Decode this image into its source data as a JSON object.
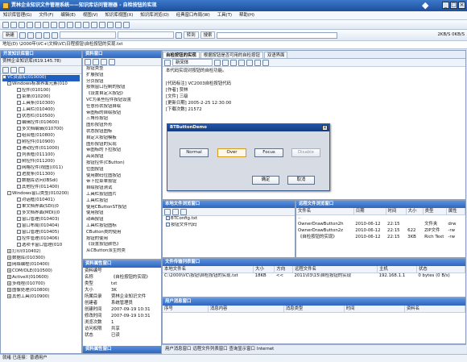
{
  "app": {
    "title": "贾林企业知识文件管理系统——知识库访问管理器 - 自检按钮的实现",
    "status": "就绪 已连接：普通用户"
  },
  "menu": [
    "知识库管理(G)",
    "文件(F)",
    "编辑(E)",
    "视图(V)",
    "知识库视图(X)",
    "知识库浏览(O)",
    "经典窗口布局(W)",
    "工具(T)",
    "帮助(H)"
  ],
  "toolbar": {
    "new_label": "新建",
    "folder_label": "转到",
    "search_label": "搜索",
    "search_placeholder": "",
    "version": "2KB/S 0KB/S"
  },
  "address": "地址(D) \\2000年\\VC+\\文档\\VC\\日程按钮\\自检按钮的实现.txt",
  "left_panel": {
    "title": "开发知识库窗口",
    "subtitle": "贾林企业知识库(619.145.78)",
    "tree": [
      "VC资源库(010000)",
      "Windows标准界面元素(010",
      "控件(010100)",
      "菜单(010200)",
      "工具条(010300)",
      "工具栏(010400)",
      "状态栏(010500)",
      "编辑控件(010600)",
      "多文档编辑(010700)",
      "组合框(010800)",
      "树控件(010900)",
      "滑动控件(011000)",
      "列表框(011100)",
      "树控件(011200)",
      "网格控件(视图)(011)",
      "进度条(011300)",
      "数据库访问(IBSdi)",
      "其他控件(011400)",
      "Windows窗口类型(010200)",
      "对话框(010401)",
      "单文档界面(SDI)(0",
      "多文档界面(MDI)(0",
      "窗口管理(010403)",
      "窗口布局(010404)",
      "窗口管理(010405)",
      "控件管理(010406)",
      "选项卡窗口管理(010",
      "打印(010402)",
      "数据库(010300)",
      "网络编程(010400)",
      "COM/OLE(010500)",
      "ActiveX(010600)",
      "多线程(010700)",
      "图像处理(010800)",
      "其他工具(010900)"
    ]
  },
  "resource_panel": {
    "title": "资料窗口",
    "items": [
      "按钮类型",
      "扩展按钮",
      "分页按钮",
      "按照窗口控制的按钮",
      "《设置自定义按钮》",
      "VC为某些控件按钮设置",
      "任意形状按钮自绘",
      "带图标的自绘按钮",
      "三角形按钮",
      "图形按钮外形",
      "状态按钮图标",
      "自定义按钮模板",
      "图形按钮的实现",
      "带图标的下拉按钮",
      "高亮按钮",
      "按钮控件(CButton)",
      "位图按钮",
      "使用数码位图按钮",
      "带下拉菜单按钮",
      "自绘按钮测试",
      "工具栏按钮图片",
      "工具栏按钮",
      "使用CButtonST按钮",
      "使用按钮",
      "动画按钮",
      "工具栏按钮图标",
      "CButton类的使用",
      "按钮的使用",
      "《设置按钮颜色》",
      "从CButton派生的类",
      "在VC中实现按钮图标",
      "在对话框中使用按钮",
      "设置按钮的颜色",
      "位图按钮类",
      "为按钮添加颜色",
      "用 Win API 实现自绘按钮"
    ],
    "properties": {
      "title": "资料属性窗口",
      "rows": [
        [
          "资料编号",
          ""
        ],
        [
          "名称",
          "《自检按钮的实现》"
        ],
        [
          "类型",
          "txt"
        ],
        [
          "大小",
          "3K"
        ],
        [
          "所属目录",
          "贾林企业知识文件"
        ],
        [
          "创建者",
          "系统管理员"
        ],
        [
          "创建时间",
          "2007-09-19 10:31"
        ],
        [
          "修改时间",
          "2007-09-19 10:31"
        ],
        [
          "浏览次数",
          "1"
        ],
        [
          "访问权限",
          "共享"
        ],
        [
          "状态",
          "已读"
        ]
      ],
      "footer": "资料属性窗口"
    }
  },
  "document": {
    "tab1": "自检按钮的实现",
    "tab2": "根据按钮是否可用的自检按钮",
    "tab3": "双语界面",
    "font_label": "新宋体",
    "content": [
      "本代码实现对按钮的自检功能。",
      "",
      "[代码标注] VC2003自检按钮代码",
      "[作者] 贾林",
      "[文件] 三级",
      "[更新日期] 2005-2-25 12:30:00",
      "[下载次数] 21572"
    ]
  },
  "dialog": {
    "title": "BTButtonDemo",
    "buttons": [
      "Normal",
      "Over",
      "Focus",
      "Disable"
    ],
    "ok": "确定",
    "cancel": "取消"
  },
  "bottom_left": {
    "title": "本地文件浏览窗口",
    "items": [
      "BTConfig.txt",
      "按钮文件代码"
    ]
  },
  "bottom_right": {
    "title": "远程文件浏览窗口",
    "headers": [
      "文件名",
      "日期",
      "时间",
      "大小",
      "类型",
      "属性"
    ],
    "rows": [
      [
        "..",
        "",
        "",
        "",
        "",
        ""
      ],
      [
        "OwnerDrawButton2h",
        "2010-06-12",
        "22:15",
        "",
        "文件夹",
        "drw"
      ],
      [
        "OwnerDrawButton2z",
        "2010-06-12",
        "22:15",
        "622",
        "ZIP文件",
        "-rw"
      ],
      [
        "《自检按钮的实现》",
        "2010-06-12",
        "22:15",
        "3KB",
        "Rich Text",
        "-rw"
      ]
    ]
  },
  "transfer": {
    "title": "文件传输列表窗口",
    "headers": [
      "本地文件名",
      "大小",
      "方向",
      "远程文件名",
      "主机",
      "状态"
    ],
    "row": [
      "C:\\2000\\VC\\按钮\\自检按钮的实现.txt",
      "18KB",
      "<<",
      "2011\\03\\15\\自检按钮的实现",
      "192.168.1.1",
      "0 bytes (0 B/s)"
    ]
  },
  "user_window": {
    "title": "用户消息窗口",
    "headers": [
      "序号",
      "消息内容",
      "消息类型",
      "时间",
      "资料名"
    ],
    "rows": []
  },
  "bottom_tabs": [
    "用户消息窗口",
    "远程文件列表窗口",
    "查询显示窗口",
    "Internet"
  ],
  "colors": {
    "title": "#1d4f9d",
    "panel_header": "#2f66bf",
    "selected": "#1f5fbf"
  }
}
